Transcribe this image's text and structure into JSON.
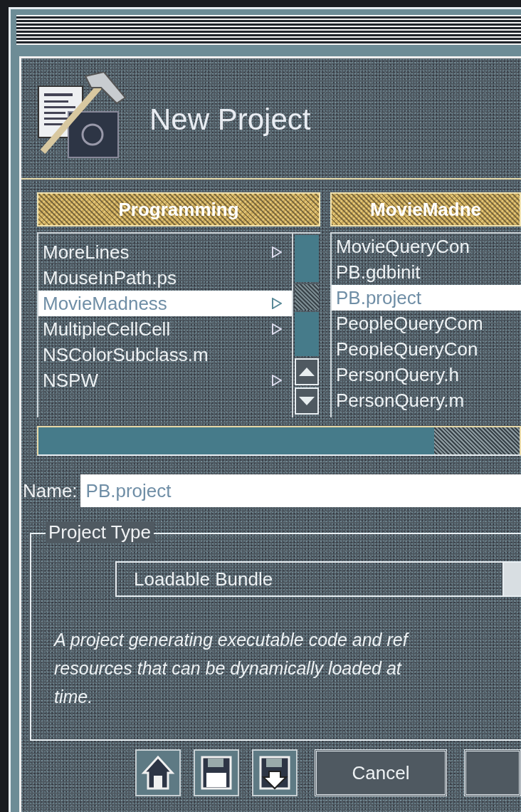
{
  "window": {
    "title": "New Project"
  },
  "browser": {
    "columns": [
      {
        "header": "Programming",
        "rows": [
          {
            "label": "MoreLines",
            "has_children": true,
            "selected": false
          },
          {
            "label": "MouseInPath.ps",
            "has_children": false,
            "selected": false
          },
          {
            "label": "MovieMadness",
            "has_children": true,
            "selected": true
          },
          {
            "label": "MultipleCellCell",
            "has_children": true,
            "selected": false
          },
          {
            "label": "NSColorSubclass.m",
            "has_children": false,
            "selected": false
          },
          {
            "label": "NSPW",
            "has_children": true,
            "selected": false
          }
        ]
      },
      {
        "header": "MovieMadne",
        "rows": [
          {
            "label": "MovieQueryCon",
            "has_children": false,
            "selected": false
          },
          {
            "label": "PB.gdbinit",
            "has_children": false,
            "selected": false
          },
          {
            "label": "PB.project",
            "has_children": false,
            "selected": true
          },
          {
            "label": "PeopleQueryCom",
            "has_children": false,
            "selected": false
          },
          {
            "label": "PeopleQueryCon",
            "has_children": false,
            "selected": false
          },
          {
            "label": "PersonQuery.h",
            "has_children": false,
            "selected": false
          },
          {
            "label": "PersonQuery.m",
            "has_children": false,
            "selected": false
          }
        ]
      }
    ]
  },
  "name_field": {
    "label": "Name:",
    "value": "PB.project"
  },
  "project_type": {
    "legend": "Project Type",
    "popup": "Loadable Bundle",
    "description": [
      "A project generating executable code and ref",
      "resources that can be dynamically loaded at",
      "time."
    ]
  },
  "buttons": [
    {
      "kind": "house"
    },
    {
      "kind": "save"
    },
    {
      "kind": "load"
    },
    {
      "kind": "text",
      "label": "Cancel"
    },
    {
      "kind": "text"
    }
  ]
}
